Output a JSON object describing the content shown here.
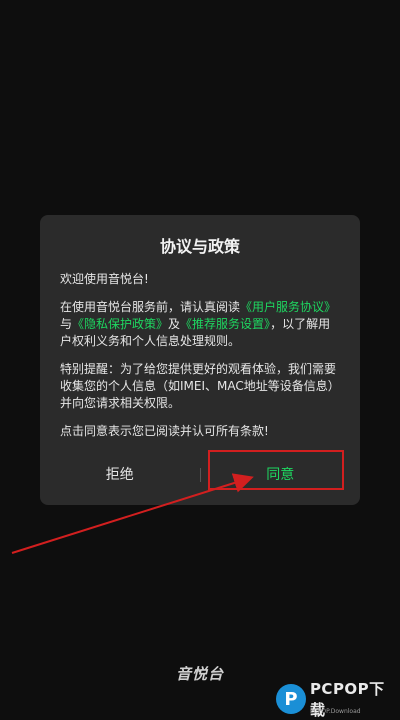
{
  "dialog": {
    "title": "协议与政策",
    "greeting": "欢迎使用音悦台!",
    "para1_prefix": "在使用音悦台服务前，请认真阅读",
    "link_user_agreement": "《用户服务协议》",
    "para1_and": "与",
    "link_privacy": "《隐私保护政策》",
    "para1_and2": "及",
    "link_recommend": "《推荐服务设置》",
    "para1_suffix": "，以了解用户权利义务和个人信息处理规则。",
    "para2": "特别提醒：为了给您提供更好的观看体验，我们需要收集您的个人信息（如IMEI、MAC地址等设备信息）并向您请求相关权限。",
    "para3": "点击同意表示您已阅读并认可所有条款!",
    "reject_label": "拒绝",
    "agree_label": "同意"
  },
  "app_logo_text": "音悦台",
  "watermark": {
    "mark": "P",
    "text": "PCPOP下载",
    "sub": "PCPOP.Download"
  },
  "colors": {
    "link": "#1ed760",
    "highlight": "#d21f1f",
    "dialog_bg": "#2b2b2b"
  }
}
